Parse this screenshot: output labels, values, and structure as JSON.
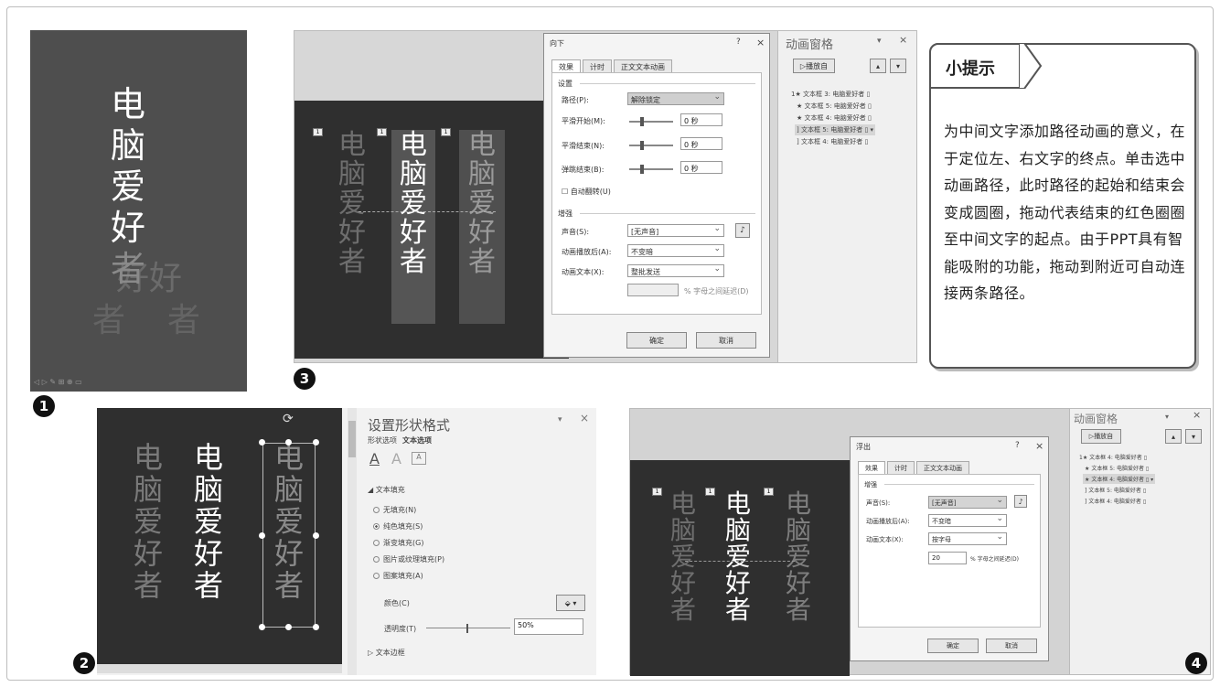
{
  "tip": {
    "title": "小提示",
    "body": "为中间文字添加路径动画的意义，在于定位左、右文字的终点。单击选中动画路径，此时路径的起始和结束会变成圆圈，拖动代表结束的红色圈圈至中间文字的起点。由于PPT具有智能吸附的功能，拖动到附近可自动连接两条路径。"
  },
  "numbers": [
    "1",
    "2",
    "3",
    "4"
  ],
  "slide_text": [
    "电",
    "脑",
    "爱",
    "好",
    "者"
  ],
  "panel3": {
    "dialog_title": "向下",
    "help": "?",
    "close": "×",
    "tabs": [
      "效果",
      "计时",
      "正文文本动画"
    ],
    "section_settings": "设置",
    "path_label": "路径(P):",
    "path_value": "解除锁定",
    "smooth_start_label": "平滑开始(M):",
    "smooth_end_label": "平滑结束(N):",
    "bounce_end_label": "弹跳结束(B):",
    "seconds": "0 秒",
    "auto_reverse": "自动翻转(U)",
    "section_enhance": "增强",
    "sound_label": "声音(S):",
    "sound_value": "[无声音]",
    "after_anim_label": "动画播放后(A):",
    "after_anim_value": "不变暗",
    "anim_text_label": "动画文本(X):",
    "anim_text_value": "整批发送",
    "letter_delay": "% 字母之间延迟(D)",
    "ok": "确定",
    "cancel": "取消",
    "pane_title": "动画窗格",
    "play_from": "播放自",
    "items": [
      "文本框 3: 电脑爱好者",
      "文本框 5: 电脑爱好者",
      "文本框 4: 电脑爱好者",
      "文本框 5: 电脑爱好者",
      "文本框 4: 电脑爱好者"
    ],
    "item_prefix": [
      "1★",
      "★",
      "★",
      "]",
      "]"
    ],
    "badges": [
      "1",
      "1",
      "1"
    ]
  },
  "panel2": {
    "title": "设置形状格式",
    "tab_shape": "形状选项",
    "tab_text": "文本选项",
    "section_fill": "文本填充",
    "opts": [
      "无填充(N)",
      "纯色填充(S)",
      "渐变填充(G)",
      "图片或纹理填充(P)",
      "图案填充(A)"
    ],
    "color_label": "颜色(C)",
    "transparency_label": "透明度(T)",
    "transparency_value": "50%",
    "section_outline": "文本边框",
    "menu_dots": "▾",
    "close": "×"
  },
  "panel4": {
    "dialog_title": "浮出",
    "help": "?",
    "close": "×",
    "tabs": [
      "效果",
      "计时",
      "正文文本动画"
    ],
    "section_enhance": "增强",
    "sound_label": "声音(S):",
    "sound_value": "[无声音]",
    "after_anim_label": "动画播放后(A):",
    "after_anim_value": "不变暗",
    "anim_text_label": "动画文本(X):",
    "anim_text_value": "按字母",
    "delay_value": "20",
    "letter_delay": "% 字母之间延迟(D)",
    "ok": "确定",
    "cancel": "取消",
    "pane_title": "动画窗格",
    "play_from": "播放自",
    "items": [
      "文本框 4: 电脑爱好者",
      "文本框 5: 电脑爱好者",
      "文本框 4: 电脑爱好者",
      "文本框 5: 电脑爱好者",
      "文本框 4: 电脑爱好者"
    ],
    "item_prefix": [
      "1★",
      "★",
      "★",
      "]",
      "]"
    ],
    "badges": [
      "1",
      "1",
      "1"
    ]
  }
}
